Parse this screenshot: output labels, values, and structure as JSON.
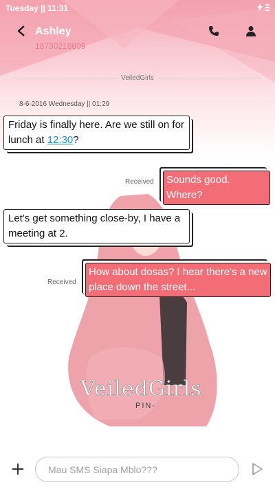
{
  "status_bar": {
    "day_time": "Tuesday || 11:31"
  },
  "header": {
    "contact_name": "Ashley",
    "contact_number": "18730218809",
    "icons": [
      "back-arrow-icon",
      "phone-icon",
      "person-icon"
    ]
  },
  "conversation": {
    "divider_label": "VeiledGirls",
    "timestamp": "8-6-2016 Wednesday || 01:29",
    "messages": [
      {
        "direction": "incoming",
        "text_before_link": "Friday is finally here. Are we still on for lunch at ",
        "link_text": "12:30",
        "text_after_link": "?"
      },
      {
        "direction": "outgoing",
        "status": "Received",
        "text": "Sounds good. Where?"
      },
      {
        "direction": "incoming",
        "text": "Let's get something close-by, I have a meeting at 2."
      },
      {
        "direction": "outgoing",
        "status": "Received",
        "text": "How about dosas? I hear there's a new place down the street..."
      }
    ]
  },
  "theme": {
    "watermark": "VeiledGirls",
    "watermark_sub": "PIN-",
    "accent": "#f26d76",
    "header_gradient_top": "#f4a9b6"
  },
  "compose": {
    "placeholder": "Mau SMS Siapa Mblo???",
    "icons": [
      "plus-icon",
      "send-icon"
    ]
  }
}
